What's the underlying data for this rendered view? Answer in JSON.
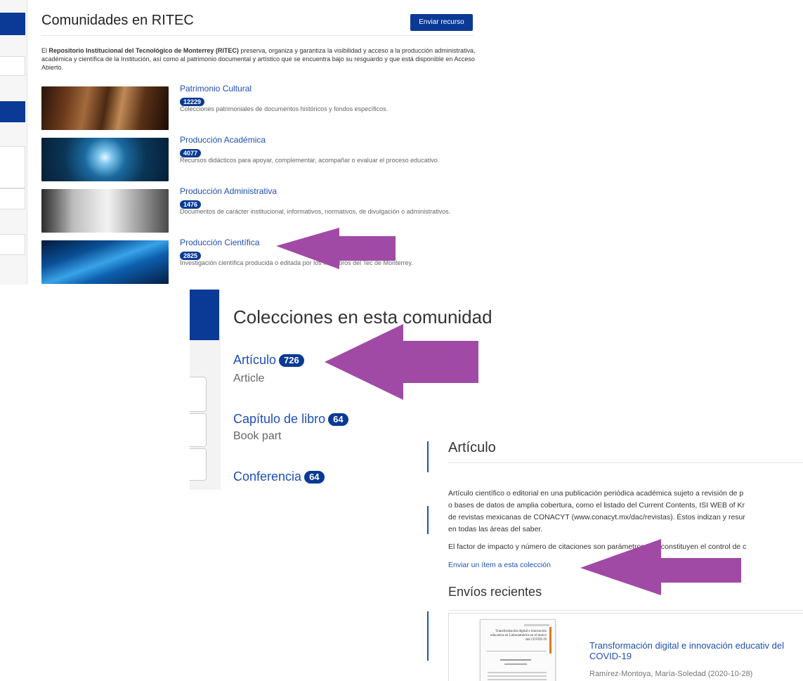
{
  "panel1": {
    "title": "Comunidades en RITEC",
    "submit_button": "Enviar recurso",
    "intro_prefix": "El ",
    "intro_bold": "Repositorio Institucional del Tecnológico de Monterrey (RITEC)",
    "intro_rest": " preserva, organiza y garantiza la visibilidad y acceso a la producción administrativa, académica y científica de la Institución, así como al patrimonio documental y artístico que se encuentra bajo su resguardo y que está disponible en Acceso Abierto.",
    "communities": [
      {
        "name": "Patrimonio Cultural",
        "count": "12229",
        "description": "Colecciones patrimoniales de documentos históricos y fondos específicos."
      },
      {
        "name": "Producción Académica",
        "count": "4077",
        "description": "Recursos didácticos para apoyar, complementar, acompañar o evaluar el proceso educativo."
      },
      {
        "name": "Producción Administrativa",
        "count": "1476",
        "description": "Documentos de carácter institucional, informativos, normativos, de divulgación o administrativos."
      },
      {
        "name": "Producción Científica",
        "count": "2825",
        "description": "Investigación científica producida o editada por los miembros del Tec de Monterrey."
      }
    ]
  },
  "panel2": {
    "title": "Colecciones en esta comunidad",
    "collections": [
      {
        "name": "Artículo",
        "count": "726",
        "subtitle": "Article"
      },
      {
        "name": "Capítulo de libro",
        "count": "64",
        "subtitle": "Book part"
      },
      {
        "name": "Conferencia",
        "count": "64",
        "subtitle": ""
      }
    ]
  },
  "panel3": {
    "title": "Artículo",
    "paragraph_lines": [
      "Artículo científico o editorial en una publicación periódica académica sujeto a revisión de p",
      "o bases de datos de amplia cobertura, como el listado del Current Contents, ISI WEB of Kr",
      "de revistas mexicanas de CONACYT (www.conacyt.mx/dac/revistas). Éstos indizan y resur",
      "en todas las áreas del saber."
    ],
    "paragraph2": "El factor de impacto y número de citaciones son parámetros que constituyen el control de c",
    "submit_link": "Enviar un ítem a esta colección",
    "recent_heading": "Envíos recientes",
    "recent_item": {
      "title": "Transformación digital e innovación educativ del COVID-19",
      "author": "Ramírez-Montoya, María-Soledad (2020-10-28)",
      "thumb_title": "Transformación digital e innovación educativa en Latinoamérica en el marco del COVID-19"
    }
  },
  "colors": {
    "accent": "#0a3a95",
    "link": "#1f4fb5",
    "arrow": "#a04aa6"
  }
}
